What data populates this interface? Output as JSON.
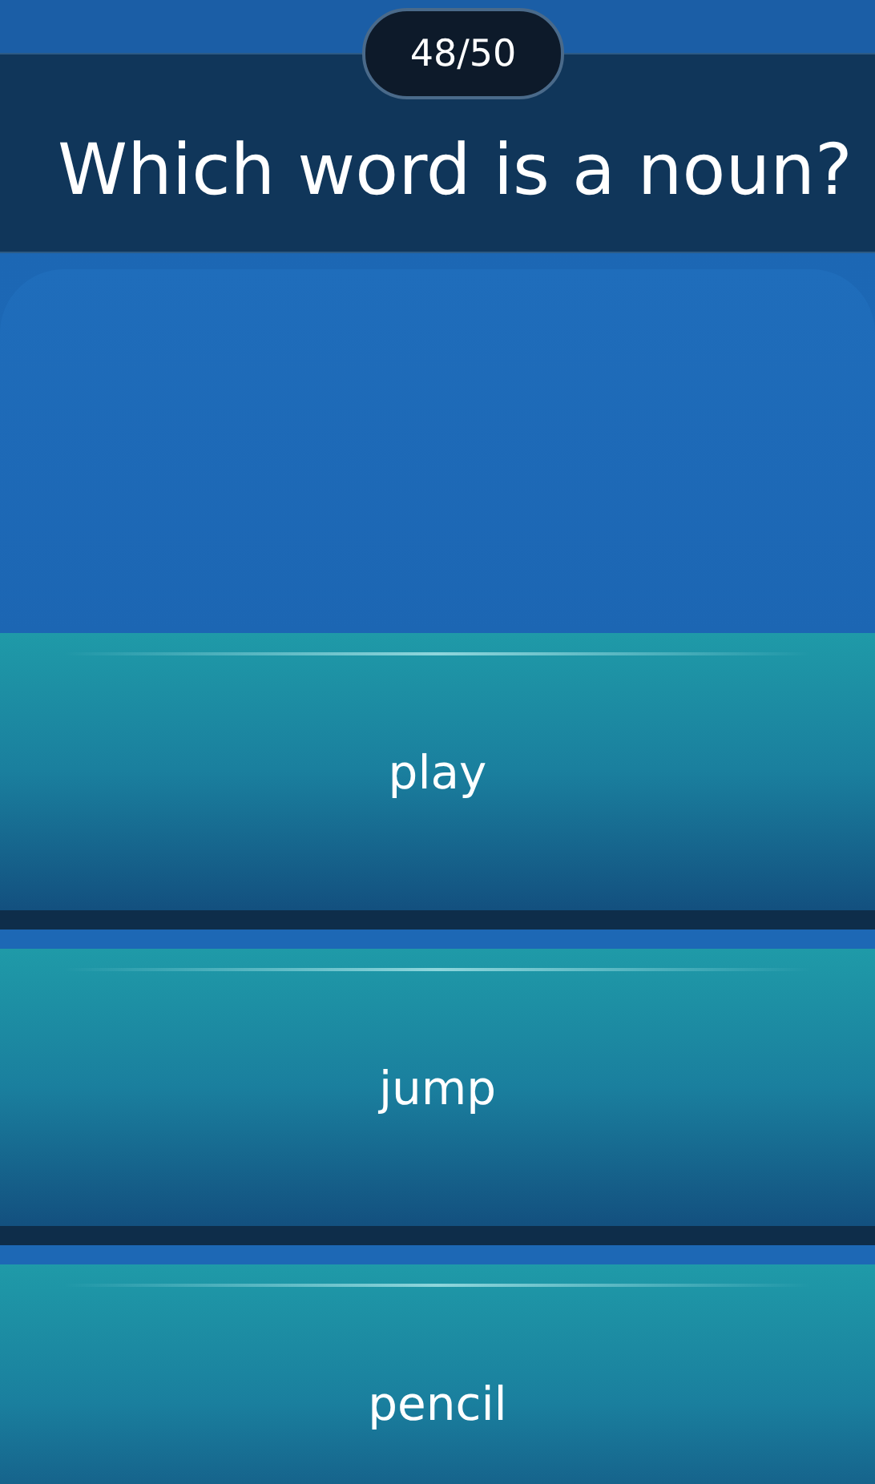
{
  "counter": "48/50",
  "question": "Which word is a noun?",
  "options": [
    {
      "label": "play"
    },
    {
      "label": "jump"
    },
    {
      "label": "pencil"
    }
  ]
}
